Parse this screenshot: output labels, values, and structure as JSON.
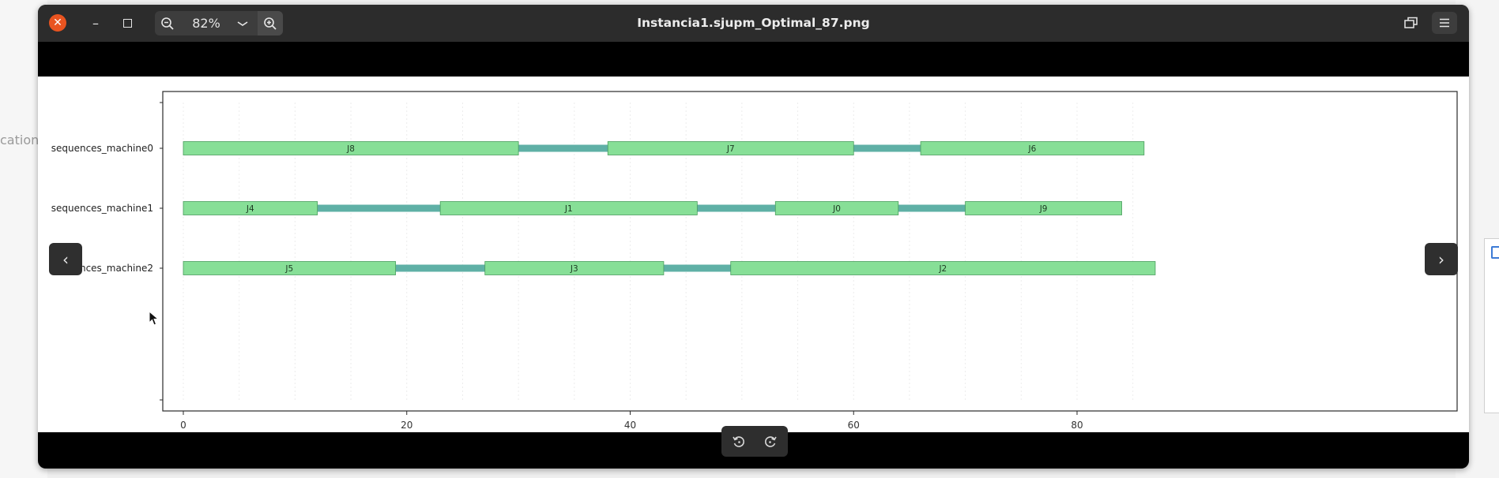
{
  "desktop": {
    "left_fragment": "cations"
  },
  "window": {
    "title": "Instancia1.sjupm_Optimal_87.png",
    "zoom_label": "82%"
  },
  "chart_data": {
    "type": "gantt",
    "title": "",
    "xlabel": "",
    "ylabel": "",
    "xlim": [
      -4.5,
      91.5
    ],
    "xticks": [
      0,
      20,
      40,
      60,
      80
    ],
    "xtick_labels": [
      "0",
      "20",
      "40",
      "60",
      "80"
    ],
    "grid": true,
    "rows": [
      {
        "label": "sequences_machine0",
        "tasks": [
          {
            "name": "J8",
            "start": 0,
            "end": 30
          },
          {
            "name": "J7",
            "start": 38,
            "end": 60
          },
          {
            "name": "J6",
            "start": 66,
            "end": 86
          }
        ],
        "gaps": [
          {
            "start": 30,
            "end": 38
          },
          {
            "start": 60,
            "end": 66
          }
        ]
      },
      {
        "label": "sequences_machine1",
        "tasks": [
          {
            "name": "J4",
            "start": 0,
            "end": 12
          },
          {
            "name": "J1",
            "start": 23,
            "end": 46
          },
          {
            "name": "J0",
            "start": 53,
            "end": 64
          },
          {
            "name": "J9",
            "start": 70,
            "end": 84
          }
        ],
        "gaps": [
          {
            "start": 12,
            "end": 23
          },
          {
            "start": 46,
            "end": 53
          },
          {
            "start": 64,
            "end": 70
          }
        ]
      },
      {
        "label": "sequences_machine2",
        "tasks": [
          {
            "name": "J5",
            "start": 0,
            "end": 19
          },
          {
            "name": "J3",
            "start": 27,
            "end": 43
          },
          {
            "name": "J2",
            "start": 49,
            "end": 87
          }
        ],
        "gaps": [
          {
            "start": 19,
            "end": 27
          },
          {
            "start": 43,
            "end": 49
          }
        ]
      }
    ],
    "colors": {
      "task": "#87df97",
      "gap": "#5fb0a6",
      "task_edge": "#4a9d5e"
    }
  }
}
